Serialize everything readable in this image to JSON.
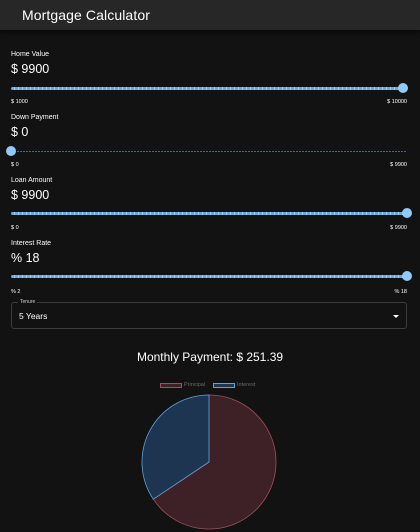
{
  "app": {
    "title": "Mortgage Calculator"
  },
  "home_value": {
    "label": "Home Value",
    "display": "$ 9900",
    "min_label": "$ 1000",
    "max_label": "$ 10000",
    "value": 9900,
    "min": 1000,
    "max": 10000
  },
  "down_payment": {
    "label": "Down Payment",
    "display": "$ 0",
    "min_label": "$ 0",
    "max_label": "$ 9900",
    "value": 0,
    "min": 0,
    "max": 9900
  },
  "loan_amount": {
    "label": "Loan Amount",
    "display": "$ 9900",
    "min_label": "$ 0",
    "max_label": "$ 9900",
    "value": 9900,
    "min": 0,
    "max": 9900
  },
  "interest_rate": {
    "label": "Interest Rate",
    "display": "% 18",
    "min_label": "% 2",
    "max_label": "% 18",
    "value": 18,
    "min": 2,
    "max": 18
  },
  "tenure": {
    "label": "Tenure",
    "selected": "5 Years"
  },
  "monthly_payment": {
    "text": "Monthly Payment: $ 251.39"
  },
  "chart_legend": {
    "principal": {
      "label": "Principal",
      "color": "#3d2126",
      "border": "#a0505c"
    },
    "interest": {
      "label": "Interest",
      "color": "#1d3550",
      "border": "#5ea2d8"
    }
  },
  "colors": {
    "accent": "#90caf9",
    "background": "#121212",
    "appbar": "#272727"
  },
  "chart_data": {
    "type": "pie",
    "labels": [
      "Principal",
      "Interest"
    ],
    "values": [
      9900,
      5183.4
    ],
    "colors": [
      "#3d2126",
      "#1d3550"
    ]
  }
}
